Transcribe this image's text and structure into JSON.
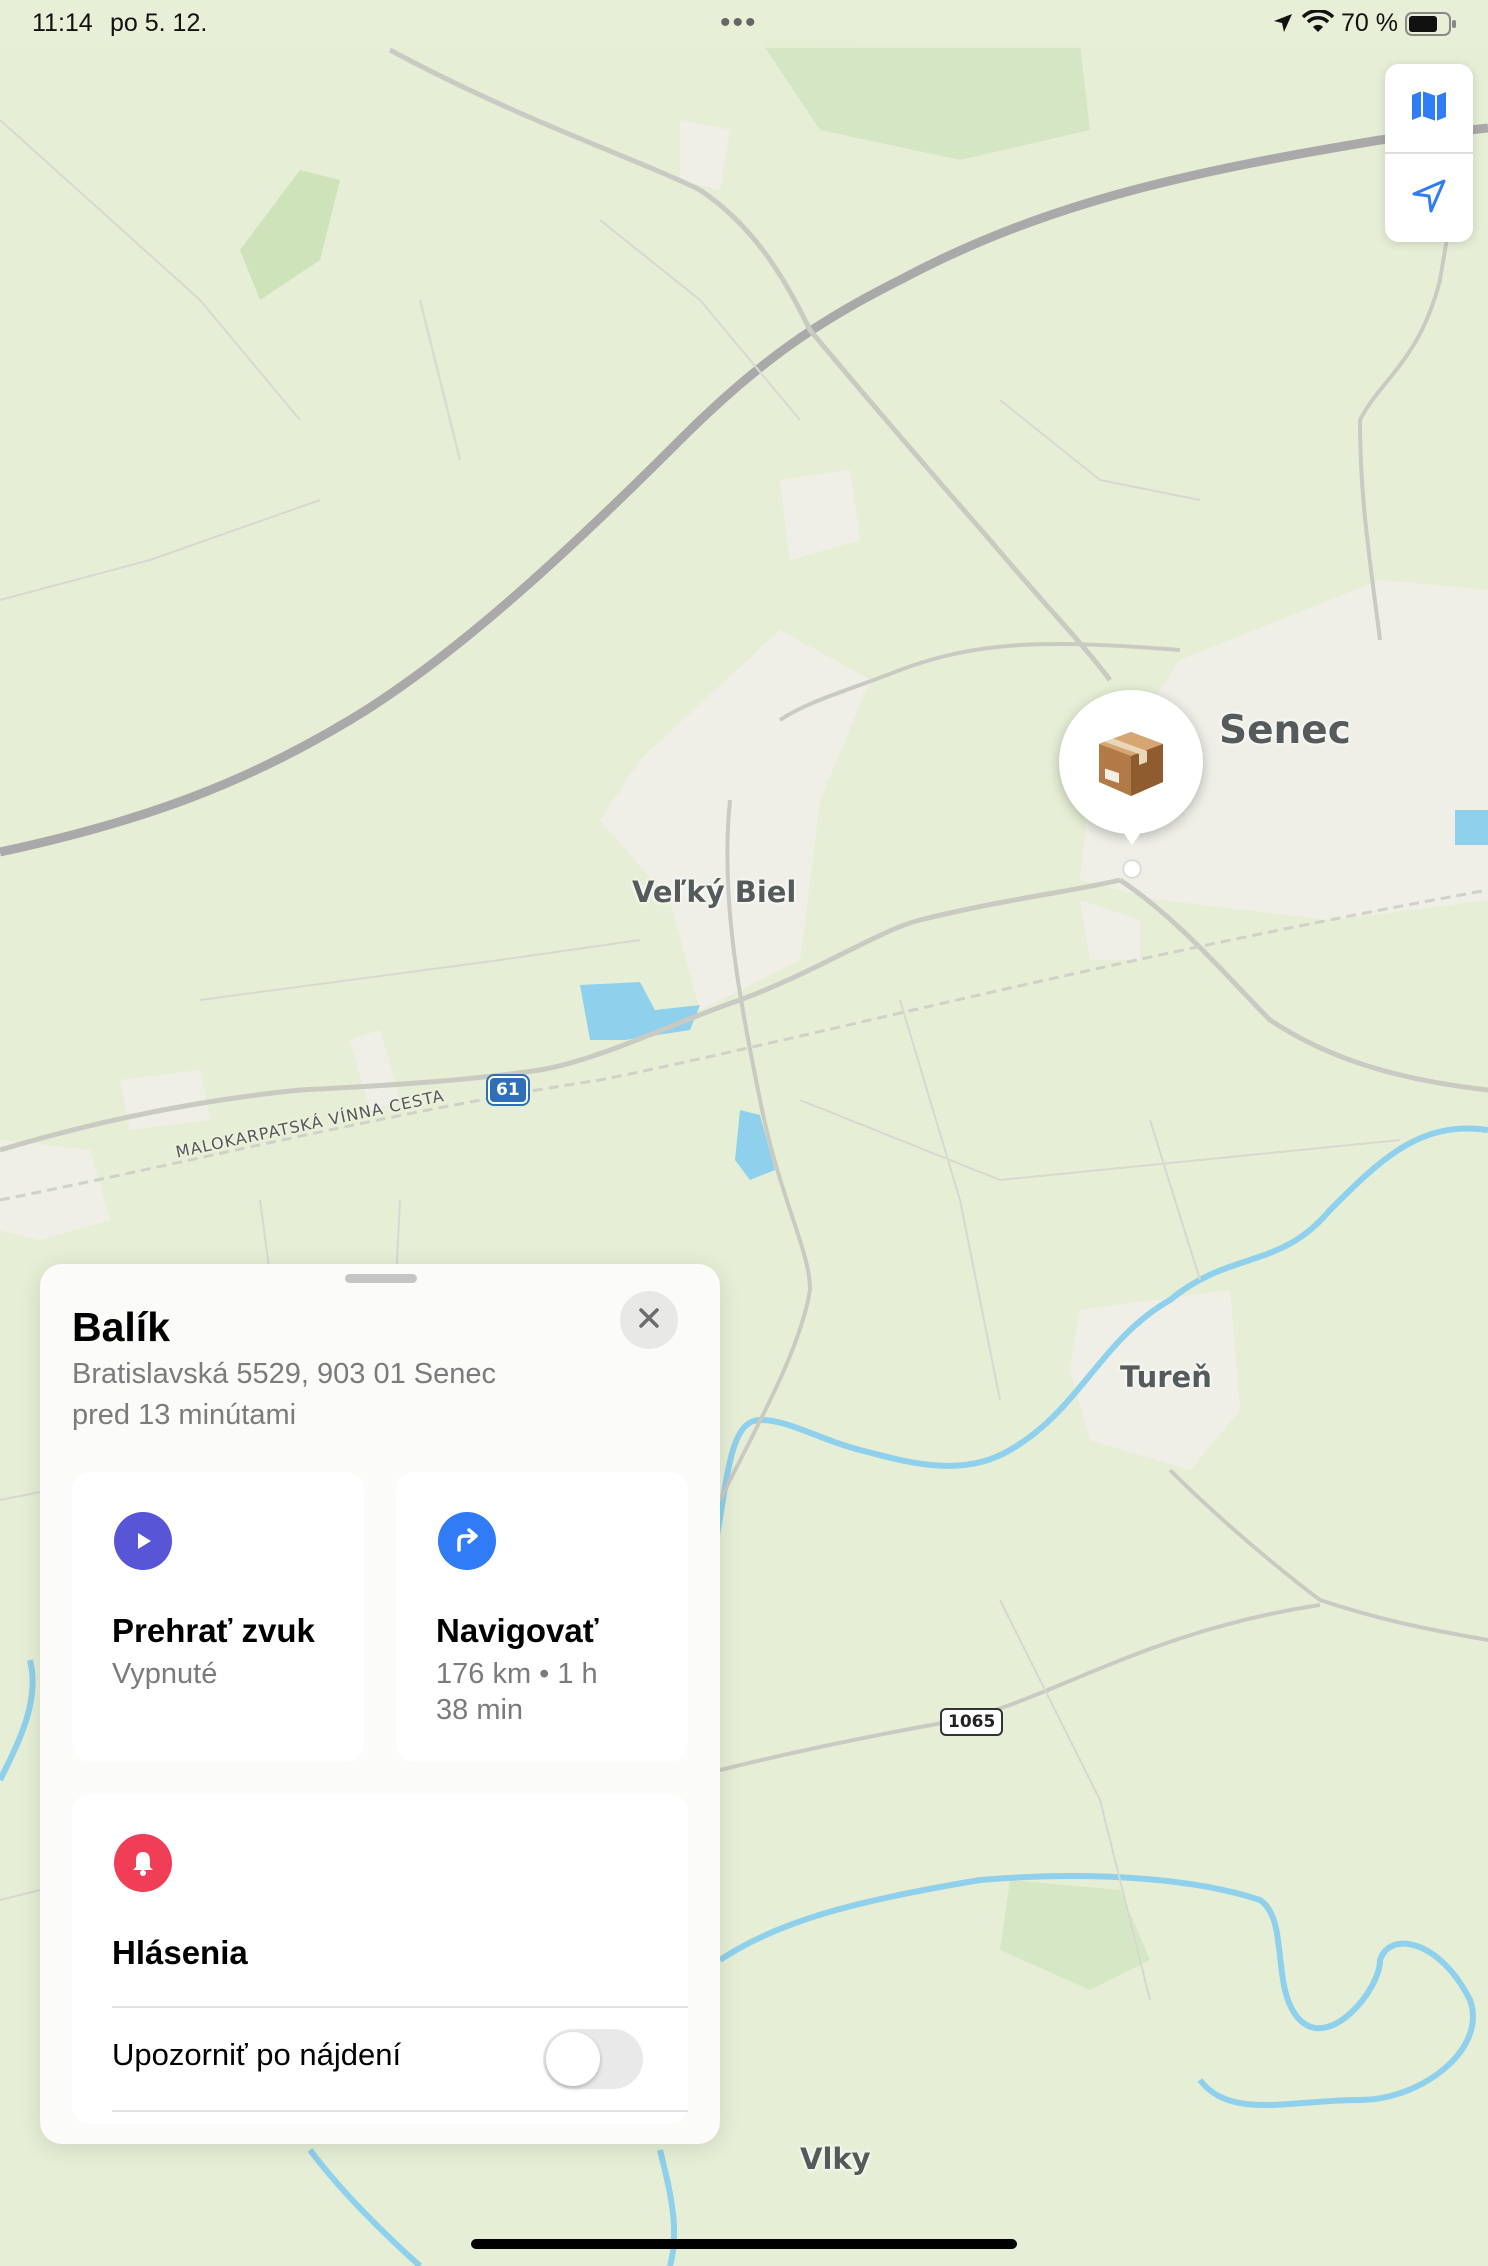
{
  "status_bar": {
    "time": "11:14",
    "date": "po 5. 12.",
    "battery": "70 %"
  },
  "map": {
    "places": {
      "senec": "Senec",
      "velky_biel": "Veľký Biel",
      "turen": "Tureň",
      "vlky": "Vlky"
    },
    "road_name": "MALOKARPATSKÁ VÍNNA CESTA",
    "route_61": "61",
    "route_1065": "1065",
    "colors": {
      "land": "#e6efd6",
      "town": "#efefe8",
      "water": "#8fd0ec",
      "highway": "#a9a9a9",
      "road": "#c9cbc2"
    }
  },
  "controls": {
    "map_icon": "map-icon",
    "location_icon": "location-arrow-icon"
  },
  "pin": {
    "icon": "package-icon"
  },
  "sheet": {
    "title": "Balík",
    "address": "Bratislavská 5529, 903 01 Senec",
    "time_ago": "pred 13 minútami",
    "play_sound": {
      "label": "Prehrať zvuk",
      "sub": "Vypnuté",
      "color": "#5856d6"
    },
    "navigate": {
      "label": "Navigovať",
      "sub_line1": "176 km • 1 h",
      "sub_line2": "38 min",
      "color": "#2f7cf6"
    },
    "notifications": {
      "label": "Hlásenia",
      "color": "#ef3e56",
      "notify_when_found": "Upozorniť po nájdení",
      "notify_enabled": false
    }
  }
}
